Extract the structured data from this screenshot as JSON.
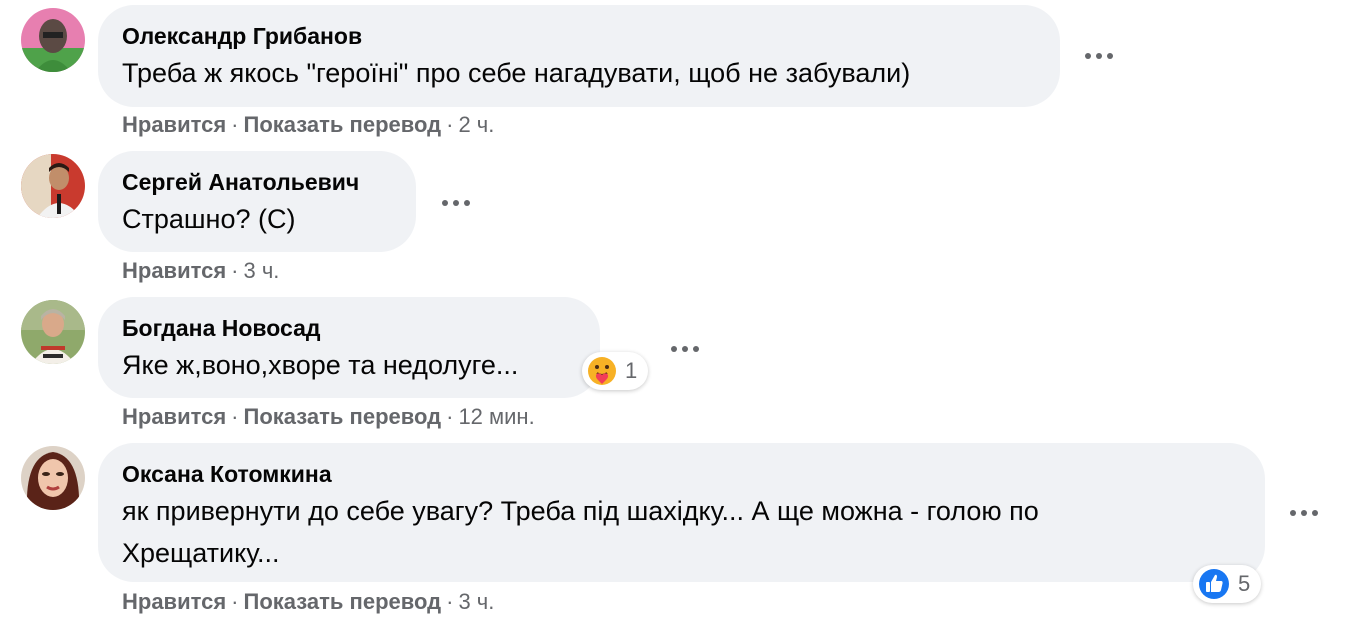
{
  "comments": [
    {
      "author": "Олександр Грибанов",
      "text": "Треба ж якось \"героїні\" про себе нагадувати, щоб не забували)",
      "like": "Нравится",
      "translate": "Показать перевод",
      "time": "2 ч.",
      "avatar_colors": [
        "#5aa54a",
        "#d84b8a"
      ]
    },
    {
      "author": "Сергей Анатольевич",
      "text": "Страшно? (С)",
      "like": "Нравится",
      "time": "3 ч."
    },
    {
      "author": "Богдана Новосад",
      "text": "Яке ж,воно,хворе та недолуге...",
      "like": "Нравится",
      "translate": "Показать перевод",
      "time": "12 мин.",
      "reaction": {
        "icon": "care-emoji-icon",
        "count": "1"
      }
    },
    {
      "author": "Оксана Котомкина",
      "text_line1": "як привернути до себе увагу? Треба під шахідку... А ще можна - голою по",
      "text_line2": "Хрещатику...",
      "like": "Нравится",
      "translate": "Показать перевод",
      "time": "3 ч.",
      "reaction": {
        "icon": "like-thumb-icon",
        "count": "5"
      }
    }
  ],
  "separator": "·",
  "colors": {
    "bubble": "#f0f2f5",
    "meta": "#65676b",
    "like_blue": "#1877f2",
    "care_yellow": "#f7b125"
  }
}
